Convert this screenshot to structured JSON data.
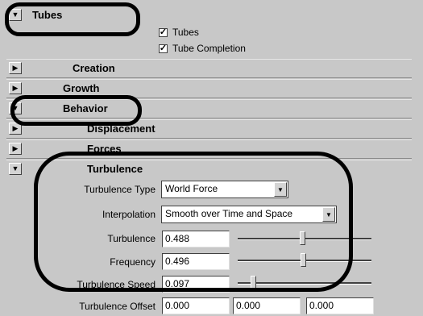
{
  "tubes": {
    "title": "Tubes",
    "checkboxes": [
      {
        "label": "Tubes",
        "checked": true
      },
      {
        "label": "Tube Completion",
        "checked": true
      }
    ]
  },
  "sections": {
    "creation": "Creation",
    "growth": "Growth",
    "behavior": "Behavior",
    "displacement": "Displacement",
    "forces": "Forces",
    "turbulence": "Turbulence"
  },
  "turbulence": {
    "type_label": "Turbulence Type",
    "type_value": "World Force",
    "interp_label": "Interpolation",
    "interp_value": "Smooth over Time and Space",
    "turb_label": "Turbulence",
    "turb_value": "0.488",
    "freq_label": "Frequency",
    "freq_value": "0.496",
    "speed_label": "Turbulence Speed",
    "speed_value": "0.097",
    "offset_label": "Turbulence Offset",
    "offset_values": [
      "0.000",
      "0.000",
      "0.000"
    ]
  },
  "icons": {
    "expanded": "triangle-down-icon",
    "collapsed": "triangle-right-icon"
  },
  "colors": {
    "panel": "#c8c8c8",
    "annotation": "#000000"
  }
}
